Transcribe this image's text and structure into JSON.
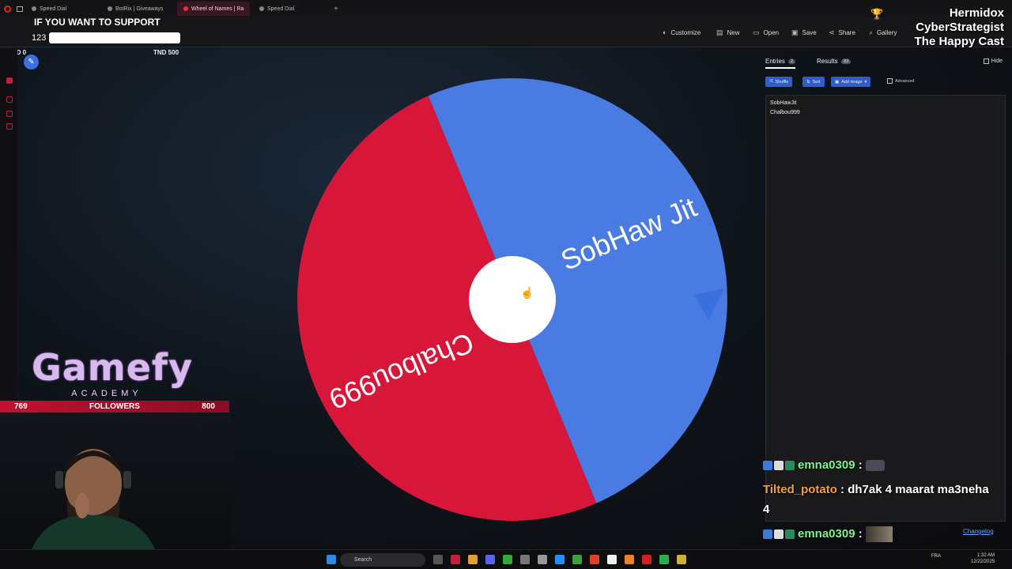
{
  "browser_tabs": [
    {
      "label": "Speed Dial",
      "active": false
    },
    {
      "label": "BotRix | Giveaways",
      "active": false
    },
    {
      "label": "Wheel of Names | Ra",
      "active": true
    },
    {
      "label": "Speed Dial",
      "active": false
    }
  ],
  "toolbar": {
    "customize": "Customize",
    "new": "New",
    "open": "Open",
    "save": "Save",
    "share": "Share",
    "gallery": "Gallery"
  },
  "overlay": {
    "support_text": "IF YOU WANT TO SUPPORT",
    "goal_value": "123",
    "goal_min": "TND 0",
    "goal_max": "TND 500",
    "brand_lines": [
      "Hermidox",
      "CyberStrategist",
      "The Happy Cast"
    ],
    "gamefy_logo": "Gamefy",
    "gamefy_sub": "ACADEMY",
    "followers_current": "769",
    "followers_label": "FOLLOWERS",
    "followers_goal": "800"
  },
  "wheel": {
    "segments": [
      {
        "label": "SobHaw Jit",
        "color": "#4a7be3"
      },
      {
        "label": "Chalbou999",
        "color": "#d8163a"
      }
    ],
    "center_color": "#ffffff",
    "pointer_color": "#3a6fe0"
  },
  "panel": {
    "tabs": [
      {
        "label": "Entries",
        "count": "2"
      },
      {
        "label": "Results",
        "count": "93"
      }
    ],
    "hide_label": "Hide",
    "buttons": {
      "shuffle": "Shuffle",
      "sort": "Sort",
      "add_image": "Add image"
    },
    "advanced_label": "Advanced",
    "entries": [
      "SobHawJit",
      "Chalbou999"
    ],
    "changelog": "Changelog"
  },
  "chat": [
    {
      "user": "emna0309",
      "message": "",
      "user_color": "#7ef28a"
    },
    {
      "user": "Tilted_potato",
      "message": "dh7ak 4 maarat ma3neha",
      "user_color": "#f0a040"
    },
    {
      "user": "",
      "message": "4",
      "user_color": "#ffffff"
    },
    {
      "user": "emna0309",
      "message": "",
      "user_color": "#7ef28a"
    }
  ],
  "taskbar": {
    "search_label": "Search",
    "lang": "FRA",
    "time": "1:32 AM",
    "date": "12/22/2025"
  }
}
